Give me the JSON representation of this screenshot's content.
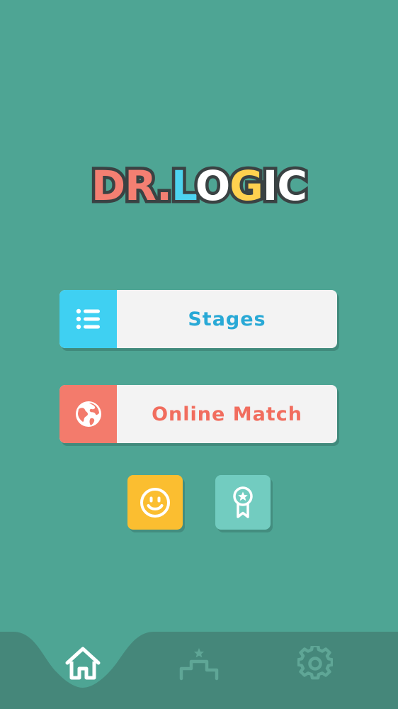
{
  "logo": {
    "letters": [
      "D",
      "R",
      ".",
      "L",
      "O",
      "G",
      "I",
      "C"
    ],
    "colors": {
      "D": "#f47f72",
      "R": "#f47f72",
      ".": "#f47f72",
      "L": "#4dd3f0",
      "O": "#ffffff",
      "G": "#ffd14f",
      "I": "#ffffff",
      "C": "#ffffff"
    }
  },
  "menu": {
    "stages_label": "Stages",
    "stages_icon": "list-icon",
    "online_label": "Online Match",
    "online_icon": "globe-icon"
  },
  "extra_buttons": {
    "emoji_icon": "smiley-icon",
    "ranking_icon": "ribbon-badge-icon"
  },
  "bottom_nav": {
    "items": [
      {
        "icon": "home-icon",
        "active": true
      },
      {
        "icon": "podium-icon",
        "active": false
      },
      {
        "icon": "gear-icon",
        "active": false
      }
    ]
  },
  "colors": {
    "background": "#4ea594",
    "nav_bar": "#45877a",
    "stages_accent": "#3fd0f2",
    "stages_text": "#29a9d6",
    "online_accent": "#f37b6c",
    "online_text": "#f16d5e",
    "emoji_button": "#fbbe30",
    "ranking_button": "#72ccc0"
  }
}
